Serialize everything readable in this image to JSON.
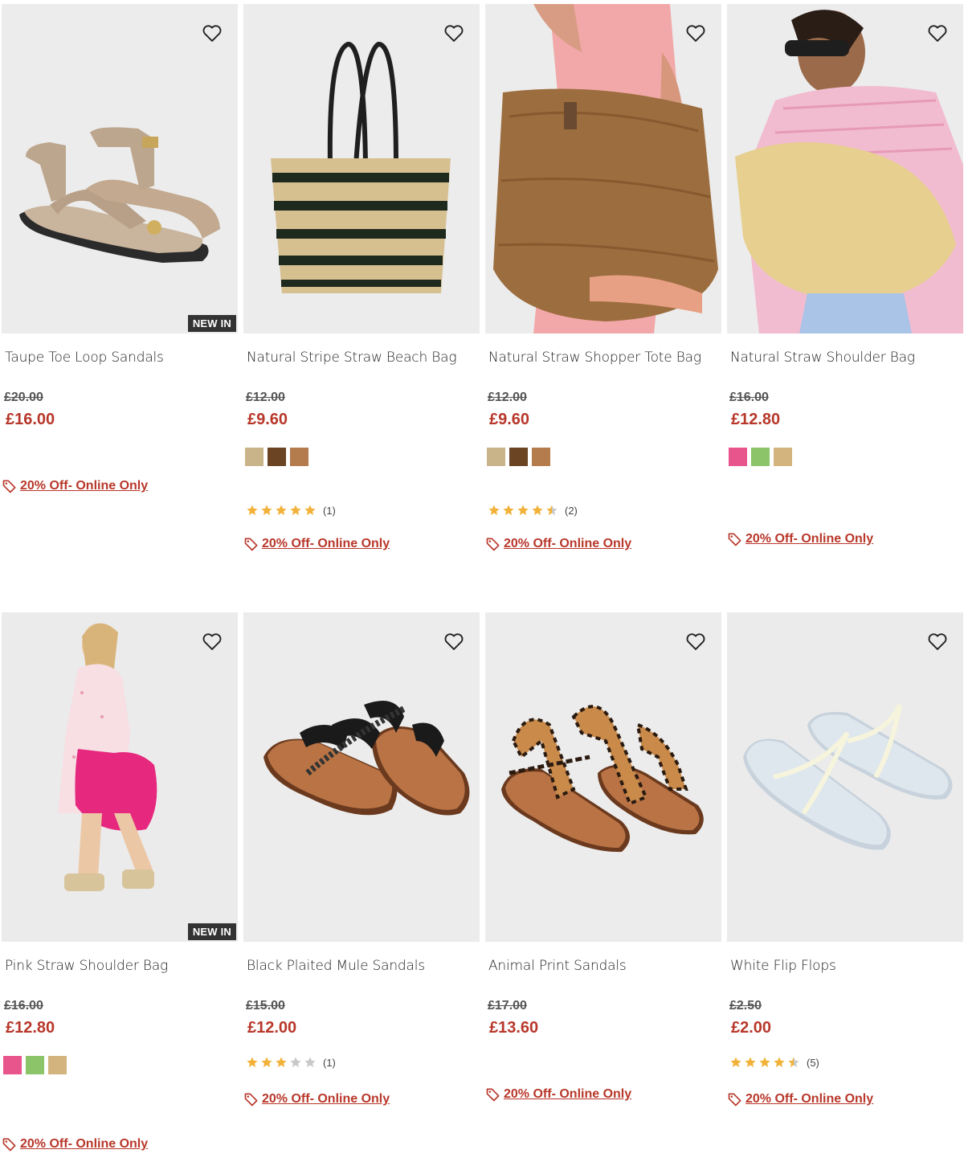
{
  "colors": {
    "price_red": "#b8372a",
    "badge_bg": "#333333",
    "star_gold": "#f2b23a",
    "star_empty": "#c8c8c8"
  },
  "products": [
    {
      "name": "Taupe Toe Loop Sandals",
      "old_price": "£20.00",
      "price": "£16.00",
      "badge": "NEW IN",
      "swatches": [],
      "rating": null,
      "review_count": "",
      "offer": "20% Off- Online Only"
    },
    {
      "name": "Natural Stripe Straw Beach Bag",
      "old_price": "£12.00",
      "price": "£9.60",
      "badge": "",
      "swatches": [
        "#c9b48a",
        "#6b4423",
        "#b47b4d"
      ],
      "rating": 5,
      "review_count": "(1)",
      "offer": "20% Off- Online Only"
    },
    {
      "name": "Natural Straw Shopper Tote Bag",
      "old_price": "£12.00",
      "price": "£9.60",
      "badge": "",
      "swatches": [
        "#c9b48a",
        "#6b4423",
        "#b47b4d"
      ],
      "rating": 4.5,
      "review_count": "(2)",
      "offer": "20% Off- Online Only"
    },
    {
      "name": "Natural Straw Shoulder Bag",
      "old_price": "£16.00",
      "price": "£12.80",
      "badge": "",
      "swatches": [
        "#e8558c",
        "#8cc46a",
        "#d4b47e"
      ],
      "rating": null,
      "review_count": "",
      "offer": "20% Off- Online Only"
    },
    {
      "name": "Pink Straw Shoulder Bag",
      "old_price": "£16.00",
      "price": "£12.80",
      "badge": "NEW IN",
      "swatches": [
        "#e8558c",
        "#8cc46a",
        "#d4b47e"
      ],
      "rating": null,
      "review_count": "",
      "offer": "20% Off- Online Only"
    },
    {
      "name": "Black Plaited Mule Sandals",
      "old_price": "£15.00",
      "price": "£12.00",
      "badge": "",
      "swatches": [],
      "rating": 3,
      "review_count": "(1)",
      "offer": "20% Off- Online Only"
    },
    {
      "name": "Animal Print Sandals",
      "old_price": "£17.00",
      "price": "£13.60",
      "badge": "",
      "swatches": [],
      "rating": null,
      "review_count": "",
      "offer": "20% Off- Online Only"
    },
    {
      "name": "White Flip Flops",
      "old_price": "£2.50",
      "price": "£2.00",
      "badge": "",
      "swatches": [],
      "rating": 4.5,
      "review_count": "(5)",
      "offer": "20% Off- Online Only"
    }
  ]
}
